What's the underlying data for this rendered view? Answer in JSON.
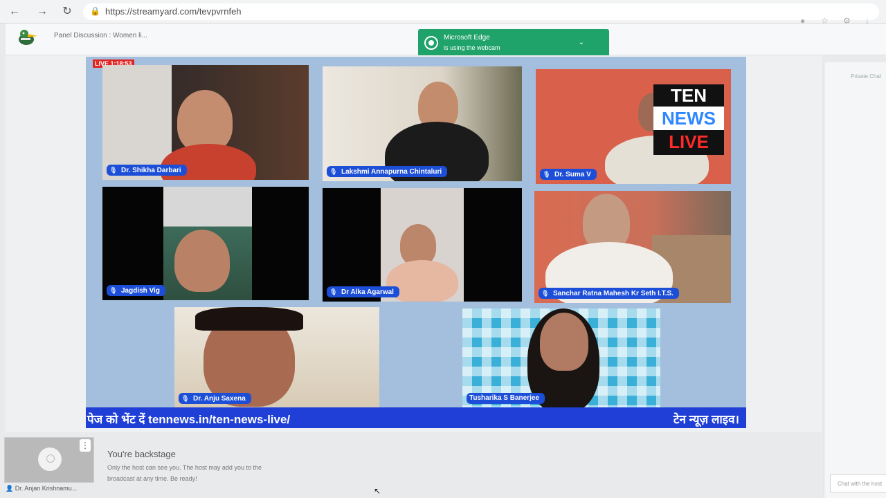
{
  "browser": {
    "url": "https://streamyard.com/tevpvrnfeh",
    "back_icon": "arrow-left",
    "forward_icon": "arrow-right",
    "reload_icon": "reload"
  },
  "header": {
    "title": "Panel Discussion : Women li..."
  },
  "webcam_notice": {
    "line1": "Microsoft Edge",
    "line2": "is using the webcam"
  },
  "stage": {
    "live_timer": "LIVE 1:18:53",
    "overlay": {
      "line1": "TEN",
      "line2": "NEWS",
      "line3": "LIVE"
    },
    "participants": [
      {
        "name": "Dr. Shikha Darbari"
      },
      {
        "name": "Lakshmi Annapurna Chintaluri"
      },
      {
        "name": "Dr. Suma V"
      },
      {
        "name": "Jagdish Vig"
      },
      {
        "name": "Dr Alka Agarwal"
      },
      {
        "name": "Sanchar Ratna Mahesh Kr Seth I.T.S."
      },
      {
        "name": "Dr. Anju Saxena"
      },
      {
        "name": "Tusharika S Banerjee"
      }
    ],
    "ticker_left": "पेज को भेंट दें tennews.in/ten-news-live/",
    "ticker_right": "टेन न्यूज़ लाइव।"
  },
  "sidebar": {
    "tab_label": "Private Chat",
    "chat_placeholder": "Chat with the host"
  },
  "backstage": {
    "participant_name": "Dr. Anjan Krishnamu...",
    "title": "You're backstage",
    "description": "Only the host can see you. The host may add you to the broadcast at any time. Be ready!"
  },
  "colors": {
    "stage_bg": "#a4bedd",
    "name_tag": "#1c4ed8",
    "ticker": "#1f3fd6",
    "live": "#e02424",
    "webcam_toast": "#20a36b"
  }
}
